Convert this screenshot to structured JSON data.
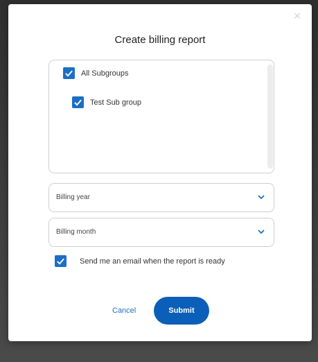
{
  "dialog": {
    "title": "Create billing report",
    "close_icon": "close-icon",
    "close_glyph": "✕"
  },
  "subgroups": {
    "items": [
      {
        "label": "All Subgroups",
        "checked": true
      },
      {
        "label": "Test Sub group",
        "checked": true
      }
    ]
  },
  "billing_year": {
    "placeholder": "Billing year",
    "icon": "chevron-down-icon"
  },
  "billing_month": {
    "placeholder": "Billing month",
    "icon": "chevron-down-icon"
  },
  "email_option": {
    "label": "Send me an email when the report is ready",
    "checked": true
  },
  "actions": {
    "cancel_label": "Cancel",
    "submit_label": "Submit"
  },
  "colors": {
    "accent": "#1d6fc4",
    "submit_bg": "#0b5fb8",
    "border": "#cfcfcf"
  }
}
